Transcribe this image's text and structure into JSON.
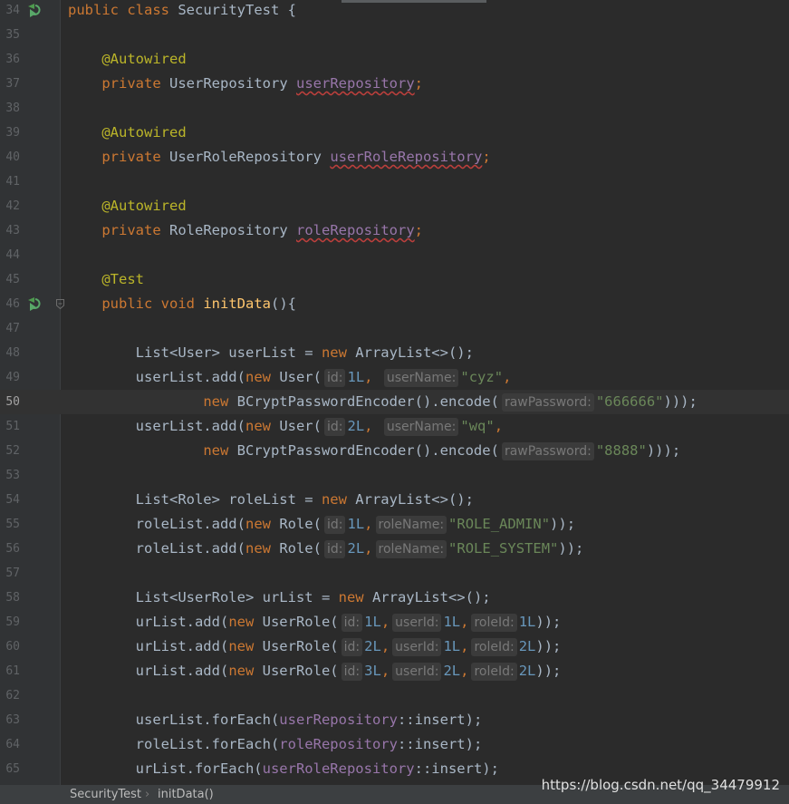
{
  "editor": {
    "current_line": "50",
    "lines": [
      {
        "n": "34"
      },
      {
        "n": "35"
      },
      {
        "n": "36"
      },
      {
        "n": "37"
      },
      {
        "n": "38"
      },
      {
        "n": "39"
      },
      {
        "n": "40"
      },
      {
        "n": "41"
      },
      {
        "n": "42"
      },
      {
        "n": "43"
      },
      {
        "n": "44"
      },
      {
        "n": "45"
      },
      {
        "n": "46"
      },
      {
        "n": "47"
      },
      {
        "n": "48"
      },
      {
        "n": "49"
      },
      {
        "n": "50"
      },
      {
        "n": "51"
      },
      {
        "n": "52"
      },
      {
        "n": "53"
      },
      {
        "n": "54"
      },
      {
        "n": "55"
      },
      {
        "n": "56"
      },
      {
        "n": "57"
      },
      {
        "n": "58"
      },
      {
        "n": "59"
      },
      {
        "n": "60"
      },
      {
        "n": "61"
      },
      {
        "n": "62"
      },
      {
        "n": "63"
      },
      {
        "n": "64"
      },
      {
        "n": "65"
      }
    ],
    "code": {
      "l34": {
        "kw": "public class",
        "name": "SecurityTest",
        "brace": "{"
      },
      "l36": {
        "ann": "@Autowired"
      },
      "l37": {
        "kw": "private",
        "type": "UserRepository",
        "field": "userRepository"
      },
      "l39": {
        "ann": "@Autowired"
      },
      "l40": {
        "kw": "private",
        "type": "UserRoleRepository",
        "field": "userRoleRepository"
      },
      "l42": {
        "ann": "@Autowired"
      },
      "l43": {
        "kw": "private",
        "type": "RoleRepository",
        "field": "roleRepository"
      },
      "l45": {
        "ann": "@Test"
      },
      "l46": {
        "kw": "public void",
        "method": "initData",
        "rest": "(){"
      },
      "l48": {
        "a": "List<User> userList = ",
        "kw": "new",
        "b": " ArrayList<>();"
      },
      "l49": {
        "a": "userList.add(",
        "kw": "new",
        "b": " User(",
        "hint1": "id:",
        "v1": "1L",
        ",1": ",",
        "hint2": "userName:",
        "v2": "\"cyz\"",
        "c": ","
      },
      "l50": {
        "kw": "new",
        "a": " BCryptPasswordEncoder().encode(",
        "hint": "rawPassword:",
        "v": "\"666666\"",
        "b": ")));"
      },
      "l51": {
        "a": "userList.add(",
        "kw": "new",
        "b": " User(",
        "hint1": "id:",
        "v1": "2L",
        "hint2": "userName:",
        "v2": "\"wq\"",
        "c": ","
      },
      "l52": {
        "kw": "new",
        "a": " BCryptPasswordEncoder().encode(",
        "hint": "rawPassword:",
        "v": "\"8888\"",
        "b": ")));"
      },
      "l54": {
        "a": "List<Role> roleList = ",
        "kw": "new",
        "b": " ArrayList<>();"
      },
      "l55": {
        "a": "roleList.add(",
        "kw": "new",
        "b": " Role(",
        "hint1": "id:",
        "v1": "1L",
        "hint2": "roleName:",
        "v2": "\"ROLE_ADMIN\"",
        "c": "));"
      },
      "l56": {
        "a": "roleList.add(",
        "kw": "new",
        "b": " Role(",
        "hint1": "id:",
        "v1": "2L",
        "hint2": "roleName:",
        "v2": "\"ROLE_SYSTEM\"",
        "c": "));"
      },
      "l58": {
        "a": "List<UserRole> urList = ",
        "kw": "new",
        "b": " ArrayList<>();"
      },
      "l59": {
        "a": "urList.add(",
        "kw": "new",
        "b": " UserRole(",
        "h1": "id:",
        "v1": "1L",
        "h2": "userId:",
        "v2": "1L",
        "h3": "roleId:",
        "v3": "1L",
        "c": "));"
      },
      "l60": {
        "a": "urList.add(",
        "kw": "new",
        "b": " UserRole(",
        "h1": "id:",
        "v1": "2L",
        "h2": "userId:",
        "v2": "1L",
        "h3": "roleId:",
        "v3": "2L",
        "c": "));"
      },
      "l61": {
        "a": "urList.add(",
        "kw": "new",
        "b": " UserRole(",
        "h1": "id:",
        "v1": "3L",
        "h2": "userId:",
        "v2": "2L",
        "h3": "roleId:",
        "v3": "2L",
        "c": "));"
      },
      "l63": {
        "a": "userList.forEach(",
        "field": "userRepository",
        "b": "::insert);"
      },
      "l64": {
        "a": "roleList.forEach(",
        "field": "roleRepository",
        "b": "::insert);"
      },
      "l65": {
        "a": "urList.forEach(",
        "field": "userRoleRepository",
        "b": "::insert);"
      }
    }
  },
  "statusbar": {
    "breadcrumb": [
      "SecurityTest",
      "initData()"
    ],
    "separator": "›"
  },
  "watermark": "https://blog.csdn.net/qq_34479912",
  "icons": {
    "run_gutter": "run-test-icon",
    "fold": "fold-marker-icon"
  },
  "colors": {
    "background": "#2b2b2b",
    "keyword": "#cc7832",
    "annotation": "#bbb529",
    "string": "#6a8759",
    "number": "#6897bb",
    "field": "#9876aa",
    "method": "#ffc66d"
  }
}
